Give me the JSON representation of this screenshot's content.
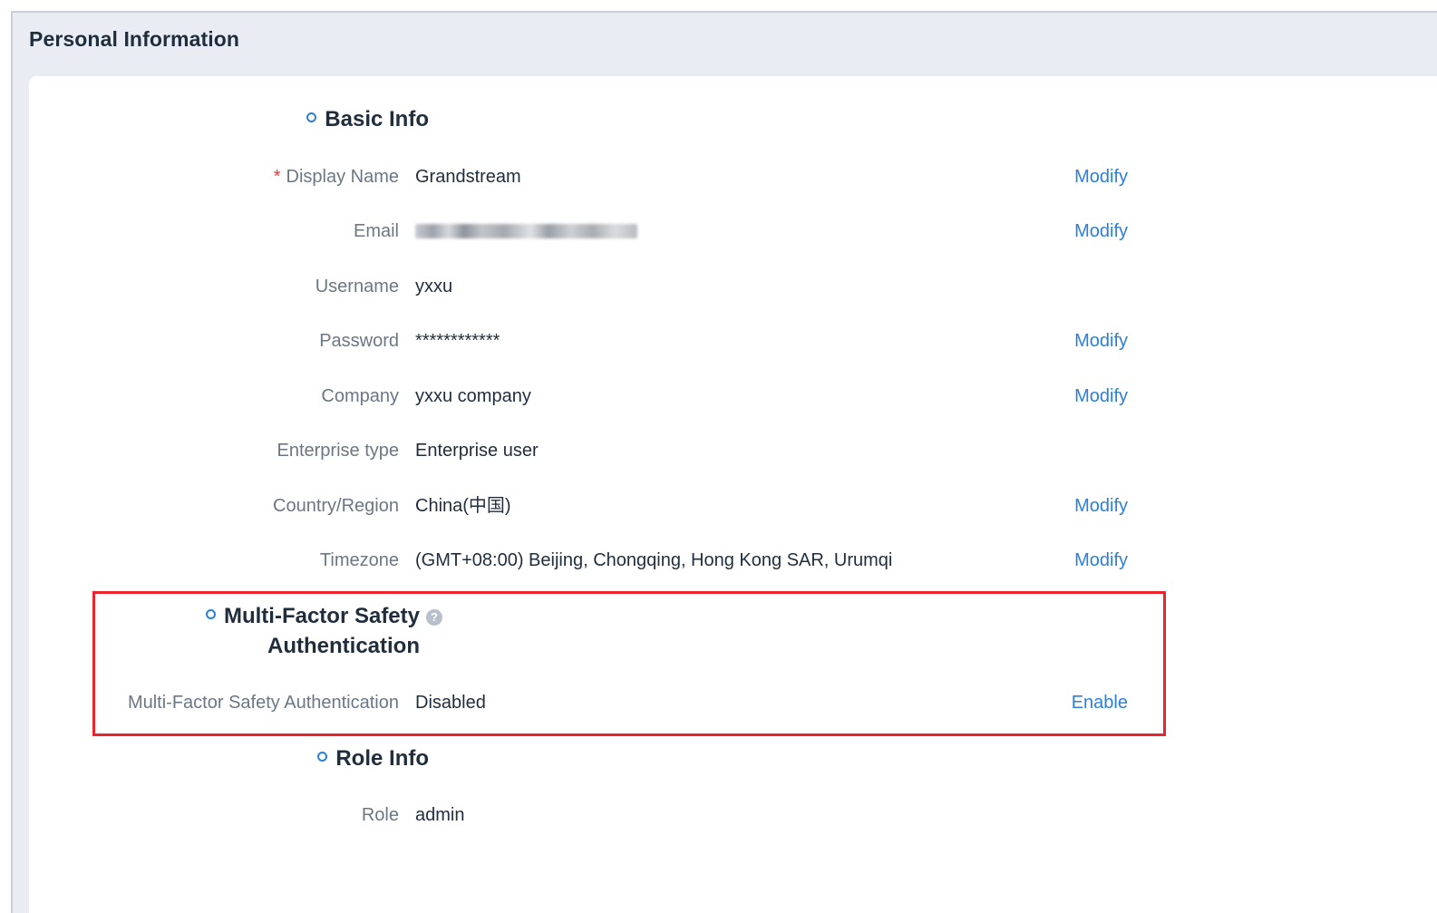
{
  "page": {
    "title": "Personal Information"
  },
  "basic_info": {
    "title": "Basic Info",
    "rows": [
      {
        "label": "Display Name",
        "required": "*",
        "value": "Grandstream",
        "action": "Modify"
      },
      {
        "label": "Email",
        "value": "",
        "action": "Modify"
      },
      {
        "label": "Username",
        "value": "yxxu",
        "action": ""
      },
      {
        "label": "Password",
        "value": "************",
        "action": "Modify"
      },
      {
        "label": "Company",
        "value": "yxxu company",
        "action": "Modify"
      },
      {
        "label": "Enterprise type",
        "value": "Enterprise user",
        "action": ""
      },
      {
        "label": "Country/Region",
        "value": "China(中国)",
        "action": "Modify"
      },
      {
        "label": "Timezone",
        "value": "(GMT+08:00) Beijing, Chongqing, Hong Kong SAR, Urumqi",
        "action": "Modify"
      }
    ]
  },
  "mfa": {
    "title_line1": "Multi-Factor Safety",
    "title_line2": "Authentication",
    "help_icon": "question-circle-icon",
    "help_glyph": "?",
    "row": {
      "label": "Multi-Factor Safety Authentication",
      "value": "Disabled",
      "action": "Enable"
    }
  },
  "role_info": {
    "title": "Role Info",
    "row": {
      "label": "Role",
      "value": "admin"
    }
  },
  "colors": {
    "accent": "#2b7fd8",
    "required": "#e4393c",
    "highlight": "#e8262b",
    "header_bg": "#e9edf3"
  }
}
